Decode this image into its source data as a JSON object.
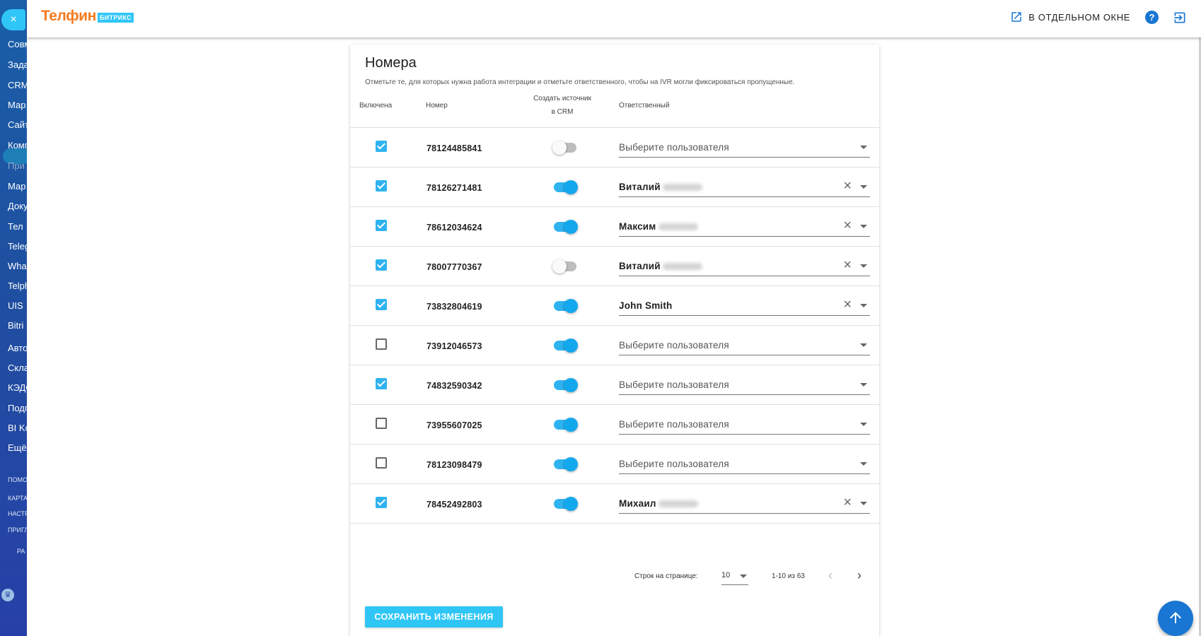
{
  "sidebar": {
    "close_glyph": "×",
    "items": [
      "Совм",
      "Зада",
      "CRM",
      "Мар",
      "Сайт",
      "Комп",
      "При",
      "Мар",
      "Доку",
      "Тел",
      "Teleg",
      "Wha",
      "Telph",
      "UIS",
      "Bitri",
      "Авто",
      "Скла",
      "КЭДС",
      "Подп",
      "BI Ko",
      "Ещё"
    ],
    "small_items": [
      "ПОМО",
      "КАРТА",
      "НАСТР",
      "ПРИГЛ",
      "РА"
    ]
  },
  "header": {
    "logo": "Телфин",
    "logo_badge": "БИТРИКС",
    "open_window_label": "В ОТДЕЛЬНОМ ОКНЕ",
    "help_glyph": "?"
  },
  "card": {
    "title": "Номера",
    "subtitle": "Отметьте те, для которых нужна работа интеграции и отметьте ответственного, чтобы на IVR могли фиксироваться пропущенные."
  },
  "columns": {
    "enabled": "Включена",
    "number": "Номер",
    "crm_source_line1": "Создать источник",
    "crm_source_line2": "в CRM",
    "responsible": "Ответственный"
  },
  "placeholder": "Выберите пользователя",
  "rows": [
    {
      "enabled": true,
      "number": "78124485841",
      "crm": false,
      "user": ""
    },
    {
      "enabled": true,
      "number": "78126271481",
      "crm": true,
      "user": "Виталий"
    },
    {
      "enabled": true,
      "number": "78612034624",
      "crm": true,
      "user": "Максим"
    },
    {
      "enabled": true,
      "number": "78007770367",
      "crm": false,
      "user": "Виталий"
    },
    {
      "enabled": true,
      "number": "73832804619",
      "crm": true,
      "user": "John Smith"
    },
    {
      "enabled": false,
      "number": "73912046573",
      "crm": true,
      "user": ""
    },
    {
      "enabled": true,
      "number": "74832590342",
      "crm": true,
      "user": ""
    },
    {
      "enabled": false,
      "number": "73955607025",
      "crm": true,
      "user": ""
    },
    {
      "enabled": false,
      "number": "78123098479",
      "crm": true,
      "user": ""
    },
    {
      "enabled": true,
      "number": "78452492803",
      "crm": true,
      "user": "Михаил"
    }
  ],
  "pagination": {
    "rows_per_page_label": "Строк на странице:",
    "rows_per_page": "10",
    "range": "1-10 из 63",
    "prev_glyph": "‹",
    "next_glyph": "›"
  },
  "save_label": "СОХРАНИТЬ ИЗМЕНЕНИЯ",
  "colors": {
    "accent": "#2fc6f6",
    "toggle_on": "#2fb3f0",
    "brand_orange": "#f47b20",
    "primary_blue": "#1976d2"
  }
}
